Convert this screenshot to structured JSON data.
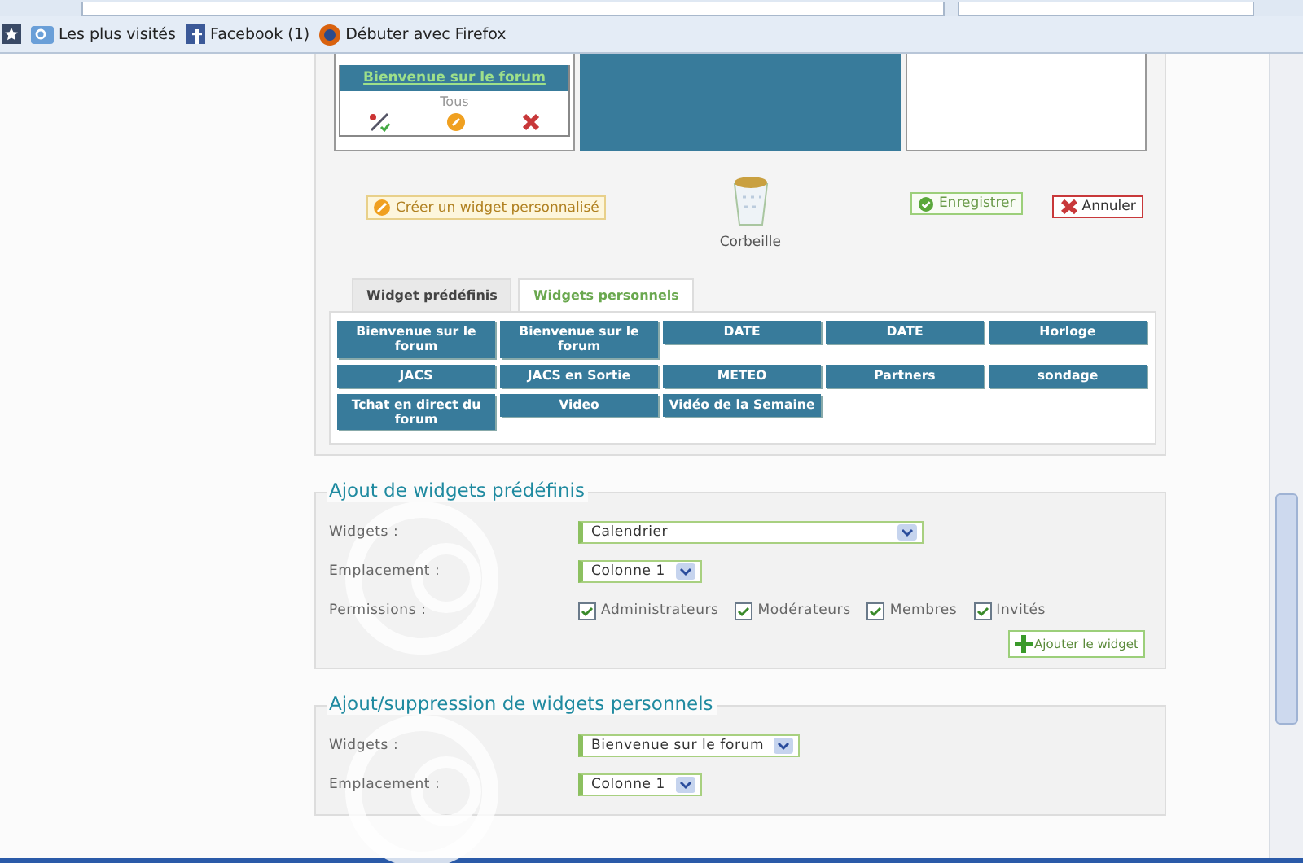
{
  "bookmarks_bar": {
    "items": [
      {
        "label": "Les plus visités"
      },
      {
        "label": "Facebook (1)"
      },
      {
        "label": "Débuter avec Firefox"
      }
    ]
  },
  "layout_preview": {
    "widget": {
      "title": "Bienvenue sur le forum",
      "permission": "Tous"
    }
  },
  "actions": {
    "create": "Créer un widget personnalisé",
    "trash": "Corbeille",
    "save": "Enregistrer",
    "cancel": "Annuler"
  },
  "tabs": [
    {
      "label": "Widget prédéfinis",
      "selected": false
    },
    {
      "label": "Widgets personnels",
      "selected": true
    }
  ],
  "widgets": [
    "Bienvenue sur le forum",
    "Bienvenue sur le forum",
    "DATE",
    "DATE",
    "Horloge",
    "JACS",
    "JACS en Sortie",
    "METEO",
    "Partners",
    "sondage",
    "Tchat en direct du forum",
    "Video",
    "Vidéo de la Semaine"
  ],
  "sections": [
    {
      "title": "Ajout de widgets prédéfinis",
      "fields": [
        {
          "kind": "select",
          "label": "Widgets :",
          "value": "Calendrier"
        },
        {
          "kind": "select",
          "label": "Emplacement :",
          "value": "Colonne 1"
        },
        {
          "kind": "checkboxes",
          "label": "Permissions :",
          "options": [
            {
              "label": "Administrateurs",
              "checked": true
            },
            {
              "label": "Modérateurs",
              "checked": true
            },
            {
              "label": "Membres",
              "checked": true
            },
            {
              "label": "Invités",
              "checked": true
            }
          ]
        }
      ],
      "button": "Ajouter le widget"
    },
    {
      "title": "Ajout/suppression de widgets personnels",
      "fields": [
        {
          "kind": "select",
          "label": "Widgets :",
          "value": "Bienvenue sur le forum"
        },
        {
          "kind": "select",
          "label": "Emplacement :",
          "value": "Colonne 1"
        }
      ]
    }
  ]
}
